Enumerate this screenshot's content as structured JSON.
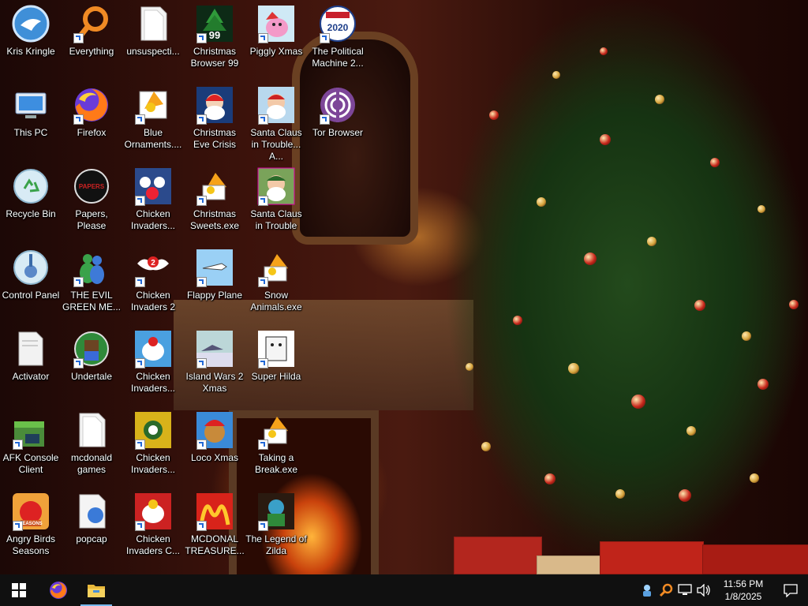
{
  "desktop": {
    "icons": [
      {
        "label": "Kris Kringle",
        "icon": "kris-kringle-icon",
        "shortcut": false
      },
      {
        "label": "Everything",
        "icon": "everything-search-icon",
        "shortcut": true
      },
      {
        "label": "unsuspecti...",
        "icon": "unsuspecting-file-icon",
        "shortcut": false
      },
      {
        "label": "Christmas Browser 99",
        "icon": "christmas-browser-icon",
        "shortcut": true
      },
      {
        "label": "Piggly Xmas",
        "icon": "piggly-xmas-icon",
        "shortcut": true
      },
      {
        "label": "The Political Machine 2...",
        "icon": "political-machine-icon",
        "shortcut": true
      },
      {
        "label": "This PC",
        "icon": "this-pc-icon",
        "shortcut": false
      },
      {
        "label": "Firefox",
        "icon": "firefox-icon",
        "shortcut": true
      },
      {
        "label": "Blue Ornaments....",
        "icon": "blue-ornaments-icon",
        "shortcut": true
      },
      {
        "label": "Christmas Eve Crisis",
        "icon": "christmas-eve-crisis-icon",
        "shortcut": true
      },
      {
        "label": "Santa Claus in Trouble... A...",
        "icon": "santa-trouble-a-icon",
        "shortcut": true
      },
      {
        "label": "Tor Browser",
        "icon": "tor-browser-icon",
        "shortcut": true
      },
      {
        "label": "Recycle Bin",
        "icon": "recycle-bin-icon",
        "shortcut": false
      },
      {
        "label": "Papers, Please",
        "icon": "papers-please-icon",
        "shortcut": false
      },
      {
        "label": "Chicken Invaders...",
        "icon": "chicken-invaders-icon",
        "shortcut": true
      },
      {
        "label": "Christmas Sweets.exe",
        "icon": "christmas-sweets-icon",
        "shortcut": true
      },
      {
        "label": "Santa Claus in Trouble",
        "icon": "santa-trouble-icon",
        "shortcut": true
      },
      {
        "label": "Control Panel",
        "icon": "control-panel-icon",
        "shortcut": false
      },
      {
        "label": "THE EVIL GREEN ME...",
        "icon": "evil-green-messenger-icon",
        "shortcut": true
      },
      {
        "label": "Chicken Invaders 2",
        "icon": "chicken-invaders-2-icon",
        "shortcut": true
      },
      {
        "label": "Flappy Plane",
        "icon": "flappy-plane-icon",
        "shortcut": true
      },
      {
        "label": "Snow Animals.exe",
        "icon": "snow-animals-icon",
        "shortcut": true
      },
      {
        "label": "Activator",
        "icon": "activator-icon",
        "shortcut": false
      },
      {
        "label": "Undertale",
        "icon": "undertale-icon",
        "shortcut": true
      },
      {
        "label": "Chicken Invaders...",
        "icon": "chicken-invaders-3-icon",
        "shortcut": true
      },
      {
        "label": "Island Wars 2 Xmas",
        "icon": "island-wars-icon",
        "shortcut": true
      },
      {
        "label": "Super Hilda",
        "icon": "super-hilda-icon",
        "shortcut": true
      },
      {
        "label": "AFK Console Client",
        "icon": "afk-console-icon",
        "shortcut": true
      },
      {
        "label": "mcdonald games",
        "icon": "mcdonald-games-icon",
        "shortcut": false
      },
      {
        "label": "Chicken Invaders...",
        "icon": "chicken-invaders-4-icon",
        "shortcut": true
      },
      {
        "label": "Loco Xmas",
        "icon": "loco-xmas-icon",
        "shortcut": true
      },
      {
        "label": "Taking a Break.exe",
        "icon": "taking-break-icon",
        "shortcut": true
      },
      {
        "label": "Angry Birds Seasons",
        "icon": "angry-birds-icon",
        "shortcut": true
      },
      {
        "label": "popcap",
        "icon": "popcap-icon",
        "shortcut": false
      },
      {
        "label": "Chicken Invaders C...",
        "icon": "chicken-invaders-c-icon",
        "shortcut": true
      },
      {
        "label": "MCDONAL TREASURE...",
        "icon": "mcdonald-treasure-icon",
        "shortcut": true
      },
      {
        "label": "The Legend of Zilda",
        "icon": "legend-zilda-icon",
        "shortcut": true
      }
    ]
  },
  "taskbar": {
    "start": "windows-start-icon",
    "pinned": [
      {
        "name": "Firefox",
        "icon": "firefox-taskbar-icon"
      },
      {
        "name": "File Explorer",
        "icon": "file-explorer-icon"
      }
    ],
    "tray": {
      "icons": [
        "tray-app-icon",
        "tray-search-icon",
        "network-icon",
        "volume-icon"
      ],
      "time": "11:56 PM",
      "date": "1/8/2025",
      "notification": "notification-icon"
    }
  },
  "colors": {
    "taskbar": "#101010",
    "accent": "#76b9ed"
  }
}
